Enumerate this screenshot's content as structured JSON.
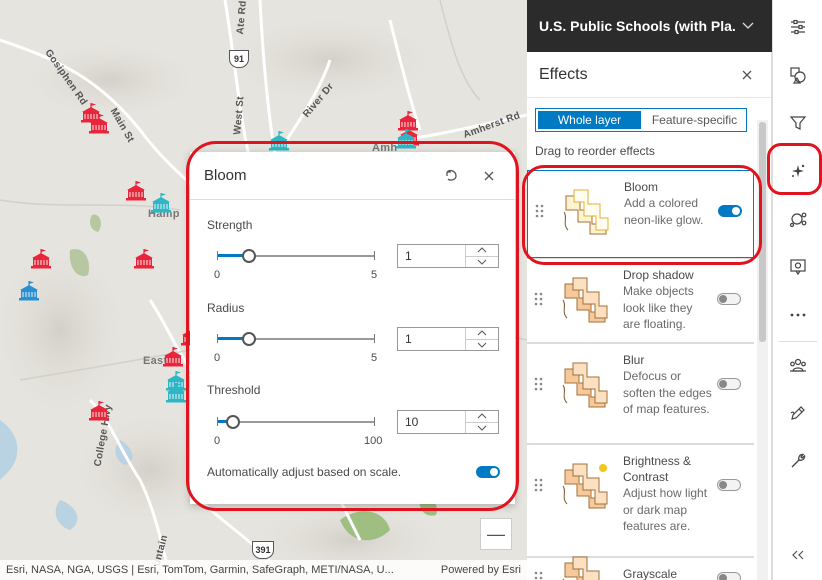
{
  "map": {
    "road_labels": [
      "Gosiphen Rd",
      "Main St",
      "West St",
      "Ate Rd",
      "River Dr",
      "Amherst Rd",
      "College Hwy",
      "untain"
    ],
    "town_labels": [
      "Hamp",
      "Amh",
      "Easth"
    ],
    "highway_shields": [
      "91",
      "391"
    ],
    "attribution_left": "Esri, NASA, NGA, USGS | Esri, TomTom, Garmin, SafeGraph, METI/NASA, U...",
    "attribution_right": "Powered by Esri",
    "zoom_out_label": "—",
    "colors": {
      "school_red": "#e8253a",
      "school_teal": "#2fb6c4",
      "school_blue": "#2a8fd1"
    }
  },
  "bloom_popup": {
    "title": "Bloom",
    "strength": {
      "label": "Strength",
      "min": "0",
      "max": "5",
      "value": "1",
      "fraction": 0.2
    },
    "radius": {
      "label": "Radius",
      "min": "0",
      "max": "5",
      "value": "1",
      "fraction": 0.2
    },
    "threshold": {
      "label": "Threshold",
      "min": "0",
      "max": "100",
      "value": "10",
      "fraction": 0.1
    },
    "auto_adjust_label": "Automatically adjust based on scale.",
    "auto_adjust_on": true
  },
  "layer_header": {
    "title": "U.S. Public Schools (with Pla..."
  },
  "effects_panel": {
    "title": "Effects",
    "tabs": [
      "Whole layer",
      "Feature-specific"
    ],
    "active_tab": "Whole layer",
    "drag_note": "Drag to reorder effects",
    "effects": [
      {
        "title": "Bloom",
        "desc": "Add a colored neon-like glow.",
        "on": true
      },
      {
        "title": "Drop shadow",
        "desc": "Make objects look like they are floating.",
        "on": false
      },
      {
        "title": "Blur",
        "desc": "Defocus or soften the edges of map features.",
        "on": false
      },
      {
        "title": "Brightness & Contrast",
        "desc": "Adjust how light or dark map features are.",
        "on": false
      },
      {
        "title": "Grayscale",
        "desc": "",
        "on": false
      }
    ]
  },
  "action_bar": {
    "items": [
      "properties-icon",
      "styles-icon",
      "filter-icon",
      "effects-icon",
      "clustering-icon",
      "popups-icon",
      "more-icon",
      "fields-icon",
      "sketch-icon",
      "configure-icon",
      "collapse-icon"
    ],
    "active": "effects-icon",
    "accent": "#007ac2"
  }
}
